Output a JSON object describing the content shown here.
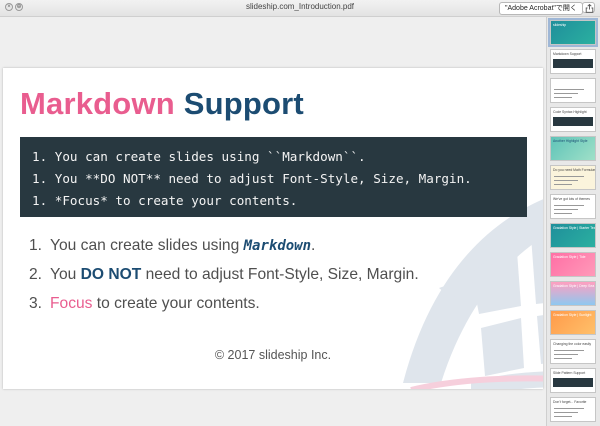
{
  "window": {
    "title": "slideship.com_Introduction.pdf",
    "open_in_label": "\"Adobe Acrobat\"で開く",
    "close_glyph": "×",
    "zoom_glyph": "⊕"
  },
  "slide": {
    "title_pink": "Markdown",
    "title_navy": "Support",
    "code_lines": [
      "1. You can create slides using ``Markdown``.",
      "1. You **DO NOT** need to adjust Font-Style, Size, Margin.",
      "1. *Focus* to create your contents."
    ],
    "list": [
      {
        "num": "1.",
        "pre": "You can create slides using ",
        "code": "Markdown",
        "post": "."
      },
      {
        "num": "2.",
        "pre": "You ",
        "bold": "DO NOT",
        "post": " need to adjust Font-Style, Size, Margin."
      },
      {
        "num": "3.",
        "focus": "Focus",
        "post": " to create your contents."
      }
    ],
    "copyright": "© 2017 slideship Inc."
  },
  "thumbnails": [
    {
      "style": "teal",
      "label": "slideship",
      "selected": true
    },
    {
      "style": "white-code",
      "label": "Markdown Support"
    },
    {
      "style": "white",
      "label": ""
    },
    {
      "style": "white-dark",
      "label": "Code Syntax Highlight"
    },
    {
      "style": "teal-light",
      "label": "Another Highlight Style"
    },
    {
      "style": "cream",
      "label": "Do you need Math Formulas?"
    },
    {
      "style": "white",
      "label": "We've got lots of themes"
    },
    {
      "style": "teal",
      "label": "Gradation Style | Starter Team"
    },
    {
      "style": "pink",
      "label": "Gradation Style | Tide"
    },
    {
      "style": "pinkblue",
      "label": "Gradation Style | Deep Sea"
    },
    {
      "style": "orange",
      "label": "Gradation Style | Sunlight"
    },
    {
      "style": "white",
      "label": "Changing the color easily"
    },
    {
      "style": "white-dark",
      "label": "Slide Pattern Support"
    },
    {
      "style": "white",
      "label": "Don't forget... Favorite"
    }
  ],
  "colors": {
    "pink": "#e95d8f",
    "navy": "#1c4c72",
    "code_bg": "#283840",
    "ship": "#dfe5ec"
  }
}
